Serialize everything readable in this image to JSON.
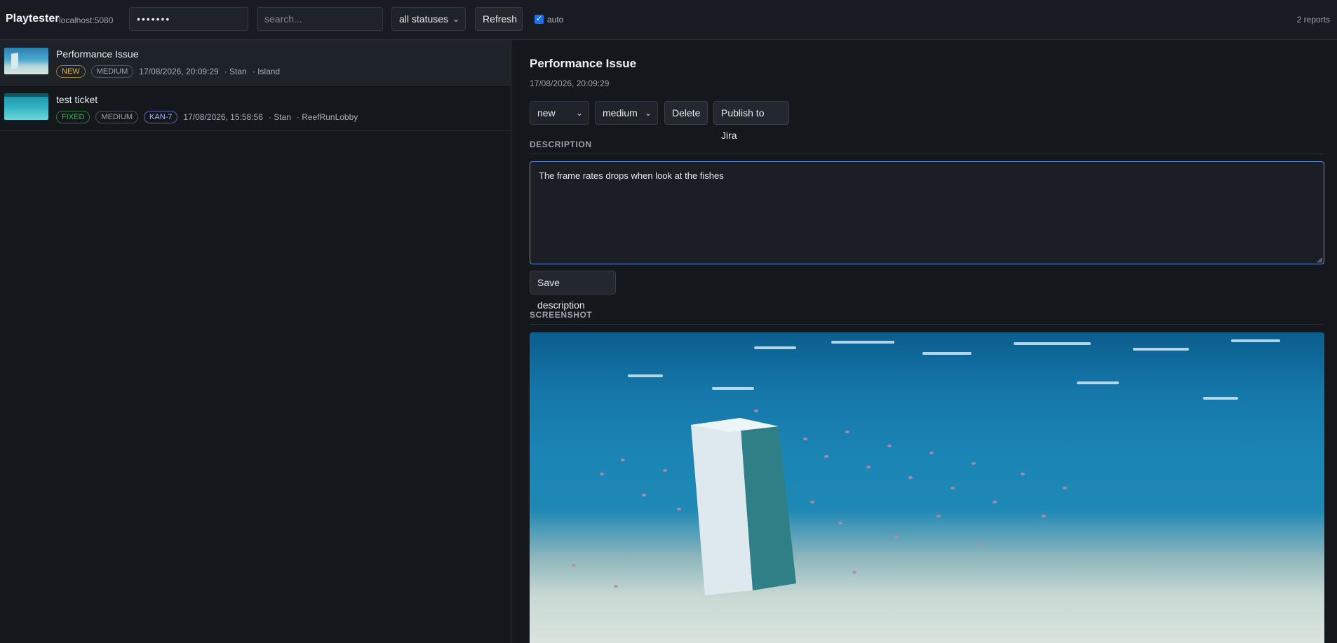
{
  "header": {
    "brand": "Playtester",
    "host": "localhost:5080",
    "key_value": "•••••••",
    "search_placeholder": "search...",
    "status_filter": "all statuses",
    "refresh_label": "Refresh",
    "auto_label": "auto",
    "auto_checked": true,
    "report_count": "2 reports"
  },
  "reports": [
    {
      "title": "Performance Issue",
      "status_badge": "NEW",
      "severity_badge": "MEDIUM",
      "timestamp": "17/08/2026, 20:09:29",
      "author": "· Stan",
      "scene": "· Island",
      "selected": true
    },
    {
      "title": "test ticket",
      "status_badge": "FIXED",
      "severity_badge": "MEDIUM",
      "jira_badge": "KAN-7",
      "timestamp": "17/08/2026, 15:58:56",
      "author": "· Stan",
      "scene": "· ReefRunLobby",
      "selected": false
    }
  ],
  "detail": {
    "title": "Performance Issue",
    "date": "17/08/2026, 20:09:29",
    "status_value": "new",
    "severity_value": "medium",
    "delete_label": "Delete",
    "publish_label": "Publish to Jira",
    "description_heading": "DESCRIPTION",
    "description_text": "The frame rates drops when look at the fishes",
    "save_label": "Save description",
    "screenshot_heading": "SCREENSHOT"
  }
}
